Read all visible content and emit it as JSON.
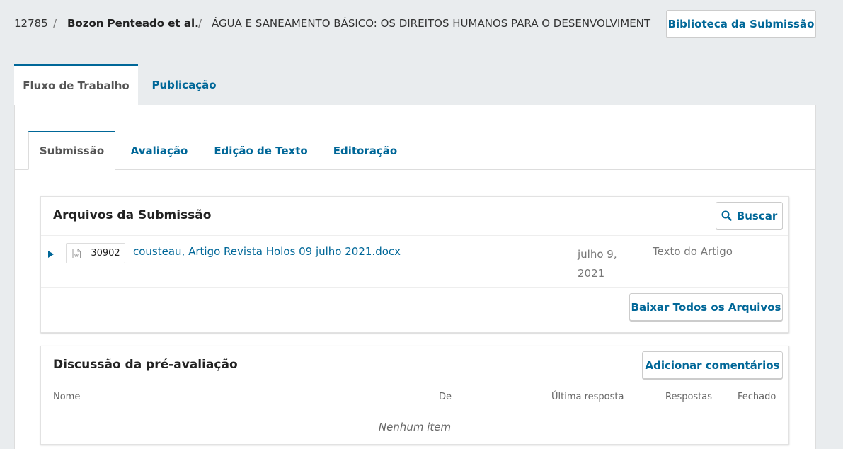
{
  "header": {
    "submission_id": "12785",
    "separator": "/",
    "author": "Bozon Penteado et al.",
    "title": "ÁGUA E SANEAMENTO BÁSICO: OS DIREITOS HUMANOS PARA O DESENVOLVIMENT",
    "library_button": "Biblioteca da Submissão"
  },
  "top_tabs": [
    {
      "label": "Fluxo de Trabalho",
      "active": true
    },
    {
      "label": "Publicação",
      "active": false
    }
  ],
  "stage_tabs": [
    {
      "label": "Submissão",
      "active": true
    },
    {
      "label": "Avaliação",
      "active": false
    },
    {
      "label": "Edição de Texto",
      "active": false
    },
    {
      "label": "Editoração",
      "active": false
    }
  ],
  "files_panel": {
    "title": "Arquivos da Submissão",
    "search_button": "Buscar",
    "files": [
      {
        "id": "30902",
        "name": "cousteau, Artigo Revista Holos 09 julho 2021.docx",
        "date_line1": "julho 9,",
        "date_line2": "2021",
        "type": "Texto do Artigo"
      }
    ],
    "download_all_button": "Baixar Todos os Arquivos"
  },
  "discussion_panel": {
    "title": "Discussão da pré-avaliação",
    "add_button": "Adicionar comentários",
    "columns": [
      "Nome",
      "De",
      "Última resposta",
      "Respostas",
      "Fechado"
    ],
    "empty_text": "Nenhum item"
  },
  "colors": {
    "accent": "#006798",
    "background": "#e9ecee"
  }
}
